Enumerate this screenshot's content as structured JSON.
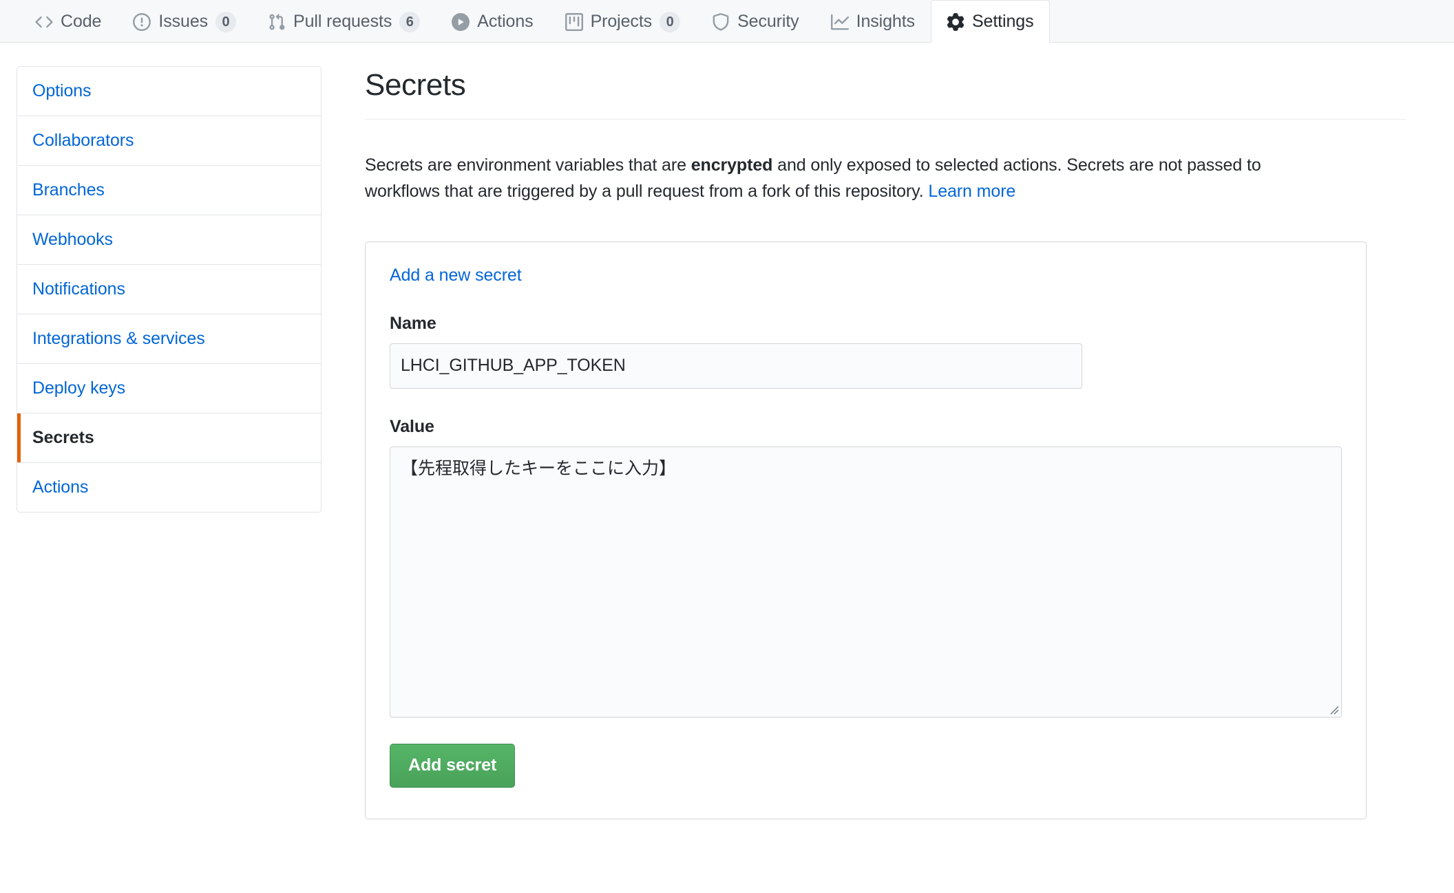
{
  "tabnav": {
    "tabs": [
      {
        "label": "Code",
        "icon": "code-icon",
        "count": null,
        "selected": false
      },
      {
        "label": "Issues",
        "icon": "issue-opened-icon",
        "count": "0",
        "selected": false
      },
      {
        "label": "Pull requests",
        "icon": "git-pull-request-icon",
        "count": "6",
        "selected": false
      },
      {
        "label": "Actions",
        "icon": "play-icon",
        "count": null,
        "selected": false
      },
      {
        "label": "Projects",
        "icon": "project-icon",
        "count": "0",
        "selected": false
      },
      {
        "label": "Security",
        "icon": "shield-icon",
        "count": null,
        "selected": false
      },
      {
        "label": "Insights",
        "icon": "graph-icon",
        "count": null,
        "selected": false
      },
      {
        "label": "Settings",
        "icon": "gear-icon",
        "count": null,
        "selected": true
      }
    ]
  },
  "sidebar": {
    "items": [
      {
        "label": "Options",
        "selected": false
      },
      {
        "label": "Collaborators",
        "selected": false
      },
      {
        "label": "Branches",
        "selected": false
      },
      {
        "label": "Webhooks",
        "selected": false
      },
      {
        "label": "Notifications",
        "selected": false
      },
      {
        "label": "Integrations & services",
        "selected": false
      },
      {
        "label": "Deploy keys",
        "selected": false
      },
      {
        "label": "Secrets",
        "selected": true
      },
      {
        "label": "Actions",
        "selected": false
      }
    ]
  },
  "main": {
    "title": "Secrets",
    "description": {
      "part1": "Secrets are environment variables that are ",
      "emphasis": "encrypted",
      "part2": " and only exposed to selected actions. Secrets are not passed to workflows that are triggered by a pull request from a fork of this repository. ",
      "link": "Learn more"
    },
    "form": {
      "heading": "Add a new secret",
      "name_label": "Name",
      "name_value": "LHCI_GITHUB_APP_TOKEN",
      "value_label": "Value",
      "value_value": "【先程取得したキーをここに入力】",
      "submit_label": "Add secret"
    }
  },
  "colors": {
    "link": "#0366d6",
    "active_marker": "#e36209",
    "primary_button": "#49a259",
    "tabbar_bg": "#f6f8fa",
    "border": "#e1e4e8"
  }
}
